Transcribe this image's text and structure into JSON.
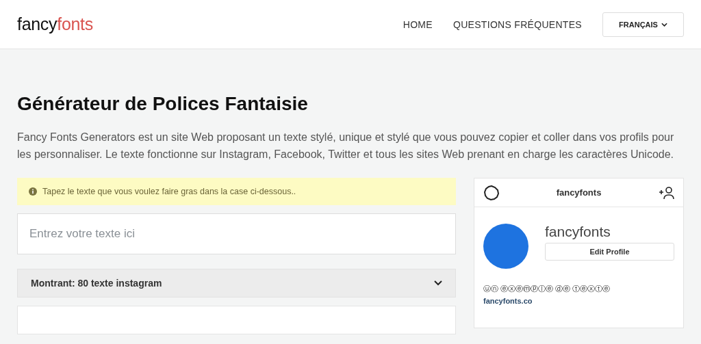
{
  "logo": {
    "text_1": "fancy",
    "text_2": "fonts"
  },
  "nav": [
    {
      "label": "HOME"
    },
    {
      "label": "QUESTIONS FRÉQUENTES"
    }
  ],
  "language_button": {
    "label": "FRANÇAIS"
  },
  "title": "Générateur de Polices Fantaisie",
  "intro": "Fancy Fonts Generators est un site Web proposant un texte stylé, unique et stylé que vous pouvez copier et coller dans vos profils pour les personnaliser. Le texte fonctionne sur Instagram, Facebook, Twitter et tous les sites Web prenant en charge les caractères Unicode.",
  "notice": "Tapez le texte que vous voulez faire gras dans la case ci-dessous..",
  "text_input": {
    "placeholder": "Entrez votre texte ici"
  },
  "filter": {
    "label": "Montrant: 80 texte instagram"
  },
  "profile_preview": {
    "header_username": "fancyfonts",
    "username": "fancyfonts",
    "edit_button": "Edit Profile",
    "bio": "ⓤⓝ ⓔⓧⓔⓜⓟⓛⓔ ⓓⓔ ⓣⓔⓧⓣⓔ",
    "link": "fancyfonts.co"
  }
}
